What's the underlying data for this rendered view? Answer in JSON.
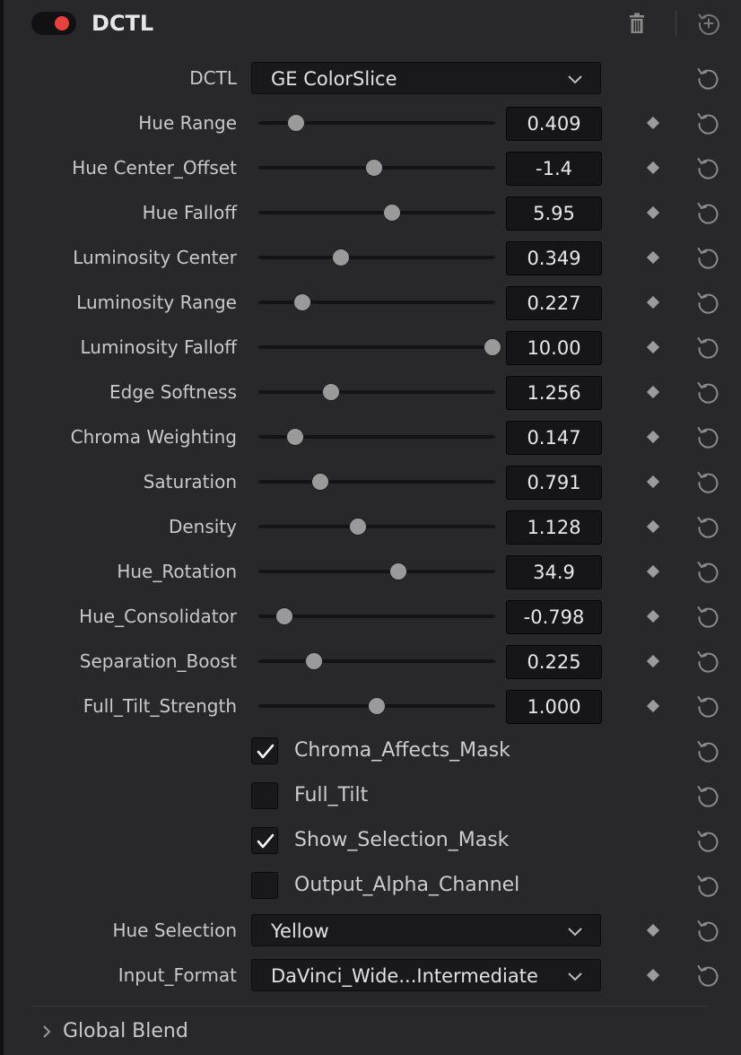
{
  "header": {
    "title": "DCTL",
    "enabled": true,
    "toggle_color": "#e8403a"
  },
  "dctl_row": {
    "label": "DCTL",
    "value": "GE ColorSlice"
  },
  "params": [
    {
      "label": "Hue Range",
      "value": "0.409",
      "slider_fraction": 0.16
    },
    {
      "label": "Hue Center_Offset",
      "value": "-1.4",
      "slider_fraction": 0.49
    },
    {
      "label": "Hue Falloff",
      "value": "5.95",
      "slider_fraction": 0.565
    },
    {
      "label": "Luminosity Center",
      "value": "0.349",
      "slider_fraction": 0.35
    },
    {
      "label": "Luminosity Range",
      "value": "0.227",
      "slider_fraction": 0.185
    },
    {
      "label": "Luminosity Falloff",
      "value": "10.00",
      "slider_fraction": 0.99
    },
    {
      "label": "Edge Softness",
      "value": "1.256",
      "slider_fraction": 0.305
    },
    {
      "label": "Chroma Weighting",
      "value": "0.147",
      "slider_fraction": 0.155
    },
    {
      "label": "Saturation",
      "value": "0.791",
      "slider_fraction": 0.26
    },
    {
      "label": "Density",
      "value": "1.128",
      "slider_fraction": 0.42
    },
    {
      "label": "Hue_Rotation",
      "value": "34.9",
      "slider_fraction": 0.59
    },
    {
      "label": "Hue_Consolidator",
      "value": "-0.798",
      "slider_fraction": 0.11
    },
    {
      "label": "Separation_Boost",
      "value": "0.225",
      "slider_fraction": 0.235
    },
    {
      "label": "Full_Tilt_Strength",
      "value": "1.000",
      "slider_fraction": 0.5
    }
  ],
  "checkboxes": [
    {
      "label": "Chroma_Affects_Mask",
      "checked": true
    },
    {
      "label": "Full_Tilt",
      "checked": false
    },
    {
      "label": "Show_Selection_Mask",
      "checked": true
    },
    {
      "label": "Output_Alpha_Channel",
      "checked": false
    }
  ],
  "dropdowns": [
    {
      "label": "Hue Selection",
      "value": "Yellow"
    },
    {
      "label": "Input_Format",
      "value": "DaVinci_Wide...Intermediate"
    }
  ],
  "footer": {
    "global_blend_label": "Global Blend"
  },
  "icons": {
    "toggle": "power-toggle-icon",
    "trash": "trash-icon",
    "add": "add-circle-icon",
    "reset": "reset-icon",
    "keyframe": "keyframe-diamond-icon",
    "chevron_down": "chevron-down-icon",
    "chevron_right": "chevron-right-icon",
    "check": "checkmark-icon"
  }
}
